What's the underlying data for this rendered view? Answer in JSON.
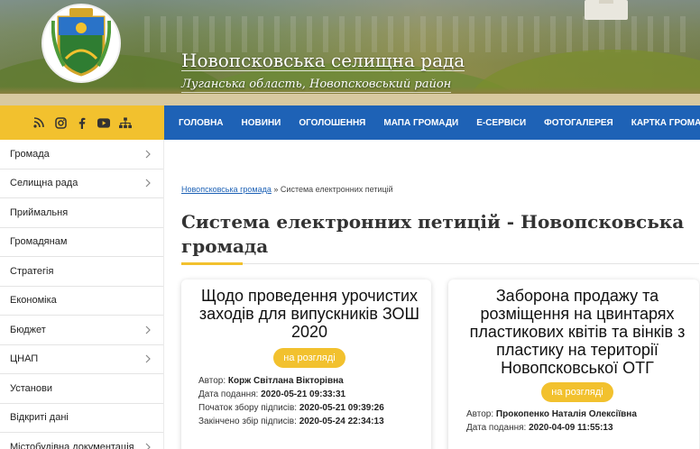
{
  "header": {
    "title": "Новопсковська селищна рада",
    "subtitle": "Луганська область, Новопсковський район"
  },
  "social_icons": [
    "rss-icon",
    "instagram-icon",
    "facebook-icon",
    "youtube-icon",
    "sitemap-icon"
  ],
  "nav": [
    "ГОЛОВНА",
    "НОВИНИ",
    "ОГОЛОШЕННЯ",
    "МАПА ГРОМАДИ",
    "Е-СЕРВІСИ",
    "ФОТОГАЛЕРЕЯ",
    "КАРТКА ГРОМАДИ"
  ],
  "sidebar": [
    {
      "label": "Громада",
      "has_submenu": true
    },
    {
      "label": "Селищна рада",
      "has_submenu": true
    },
    {
      "label": "Приймальня",
      "has_submenu": false
    },
    {
      "label": "Громадянам",
      "has_submenu": false
    },
    {
      "label": "Стратегія",
      "has_submenu": false
    },
    {
      "label": "Економіка",
      "has_submenu": false
    },
    {
      "label": "Бюджет",
      "has_submenu": true
    },
    {
      "label": "ЦНАП",
      "has_submenu": true
    },
    {
      "label": "Установи",
      "has_submenu": false
    },
    {
      "label": "Відкриті дані",
      "has_submenu": false
    },
    {
      "label": "Містобудівна документація",
      "has_submenu": true
    }
  ],
  "breadcrumb": {
    "home": "Новопсковська громада",
    "separator": "»",
    "current": "Система електронних петицій"
  },
  "page_title": "Система електронних петицій - Новопсковська громада",
  "petitions": [
    {
      "title": "Щодо проведення урочистих заходів для випускників ЗОШ 2020",
      "status": "на розгляді",
      "author_label": "Автор:",
      "author": "Корж Світлана Вікторівна",
      "submitted_label": "Дата подання:",
      "submitted": "2020-05-21 09:33:31",
      "start_label": "Початок збору підписів:",
      "start": "2020-05-21 09:39:26",
      "end_label": "Закінчено збір підписів:",
      "end": "2020-05-24 22:34:13"
    },
    {
      "title": "Заборона продажу та розміщення на цвинтарях пластикових квітів та вінків з пластику на території Новопсковської ОТГ",
      "status": "на розгляді",
      "author_label": "Автор:",
      "author": "Прокопенко Наталія Олексіївна",
      "submitted_label": "Дата подання:",
      "submitted": "2020-04-09 11:55:13"
    }
  ],
  "colors": {
    "accent_yellow": "#f2c12e",
    "nav_blue": "#1e62b6"
  }
}
